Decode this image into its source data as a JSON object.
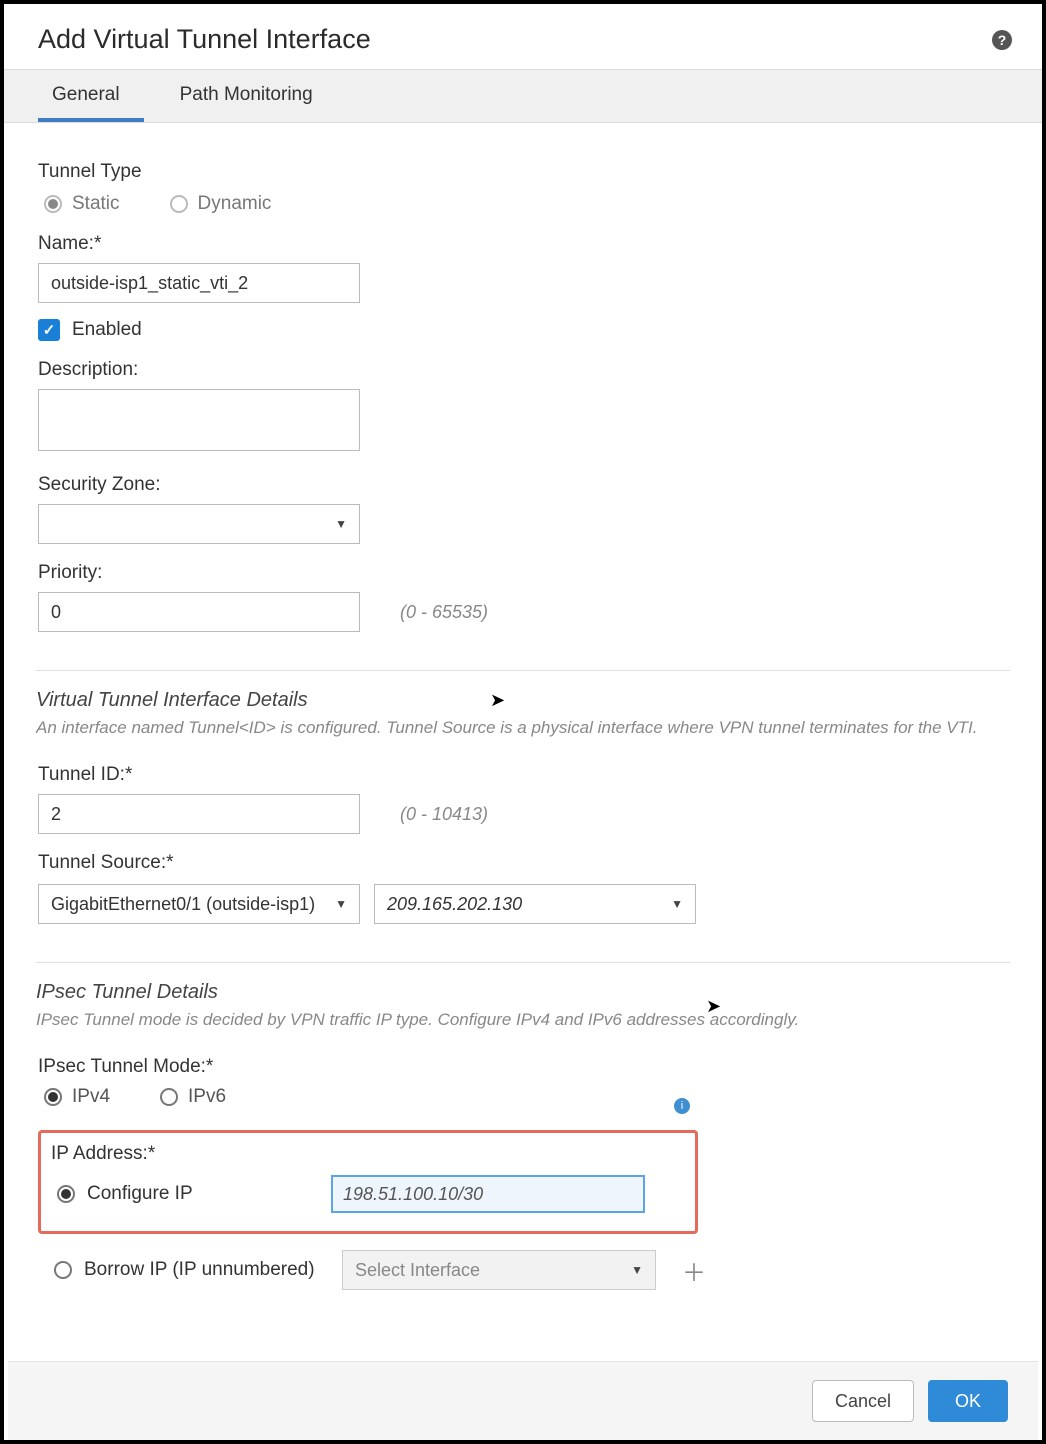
{
  "header": {
    "title": "Add Virtual Tunnel Interface"
  },
  "tabs": {
    "general": "General",
    "path": "Path Monitoring"
  },
  "tunnelType": {
    "label": "Tunnel Type",
    "static": "Static",
    "dynamic": "Dynamic"
  },
  "name": {
    "label": "Name:*",
    "value": "outside-isp1_static_vti_2"
  },
  "enabled": {
    "label": "Enabled"
  },
  "description": {
    "label": "Description:",
    "value": ""
  },
  "securityZone": {
    "label": "Security Zone:"
  },
  "priority": {
    "label": "Priority:",
    "value": "0",
    "hint": "(0 - 65535)"
  },
  "vtiSection": {
    "title": "Virtual Tunnel Interface Details",
    "desc": "An interface named Tunnel<ID> is configured. Tunnel Source is a physical interface where VPN tunnel terminates for the VTI."
  },
  "tunnelId": {
    "label": "Tunnel ID:*",
    "value": "2",
    "hint": "(0 - 10413)"
  },
  "tunnelSource": {
    "label": "Tunnel Source:*",
    "iface": "GigabitEthernet0/1 (outside-isp1)",
    "ip": "209.165.202.130"
  },
  "ipsecSection": {
    "title": "IPsec Tunnel Details",
    "desc": "IPsec Tunnel mode is decided by VPN traffic IP type. Configure IPv4 and IPv6 addresses accordingly."
  },
  "ipsecMode": {
    "label": "IPsec Tunnel Mode:*",
    "v4": "IPv4",
    "v6": "IPv6"
  },
  "ipAddress": {
    "label": "IP Address:*",
    "configure": "Configure IP",
    "value": "198.51.100.10/30",
    "borrow": "Borrow IP (IP unnumbered)",
    "selectIface": "Select Interface"
  },
  "footer": {
    "cancel": "Cancel",
    "ok": "OK"
  }
}
